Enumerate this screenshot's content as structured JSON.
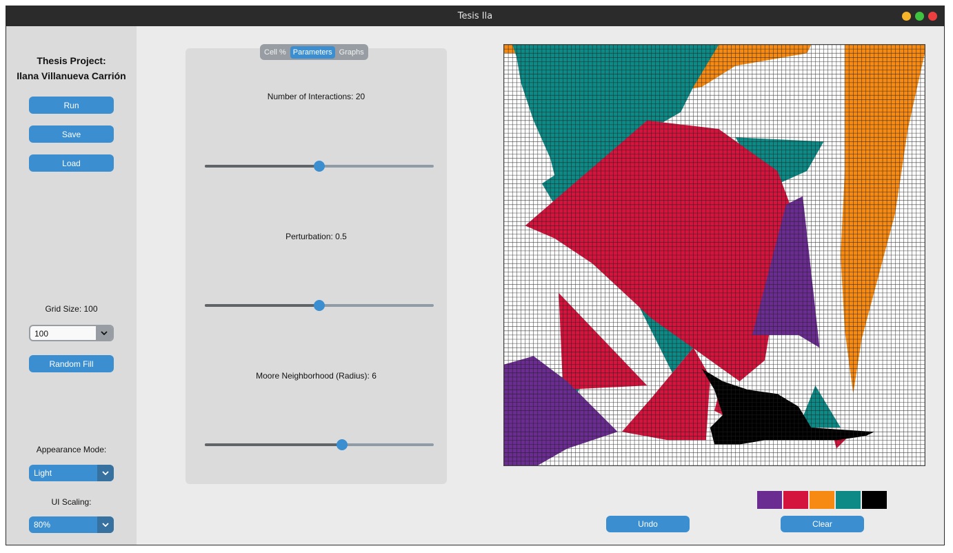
{
  "window": {
    "title": "Tesis Ila"
  },
  "sidebar": {
    "title_line1": "Thesis Project:",
    "title_line2": "Ilana Villanueva Carrión",
    "run_label": "Run",
    "save_label": "Save",
    "load_label": "Load",
    "grid_size_label": "Grid Size: 100",
    "grid_size_value": "100",
    "random_fill_label": "Random Fill",
    "appearance_label": "Appearance Mode:",
    "appearance_value": "Light",
    "scaling_label": "UI Scaling:",
    "scaling_value": "80%"
  },
  "tabs": [
    {
      "label": "Cell %",
      "active": false
    },
    {
      "label": "Parameters",
      "active": true
    },
    {
      "label": "Graphs",
      "active": false
    }
  ],
  "parameters": {
    "interactions_label": "Number of Interactions: 20",
    "interactions_fraction": 0.5,
    "perturbation_label": "Perturbation: 0.5",
    "perturbation_fraction": 0.5,
    "radius_label": "Moore Neighborhood (Radius): 6",
    "radius_fraction": 0.6
  },
  "canvas": {
    "grid_size": 100,
    "colors": {
      "purple": "#6a2c91",
      "red": "#d4143c",
      "orange": "#f78a12",
      "teal": "#0d8a86",
      "black": "#000000",
      "empty": "#ffffff",
      "line": "#202020"
    }
  },
  "palette": [
    "#6a2c91",
    "#d4143c",
    "#f78a12",
    "#0d8a86",
    "#000000"
  ],
  "actions": {
    "undo_label": "Undo",
    "clear_label": "Clear"
  },
  "theme": {
    "accent": "#3b8ed0",
    "accent_dark": "#36719f"
  }
}
